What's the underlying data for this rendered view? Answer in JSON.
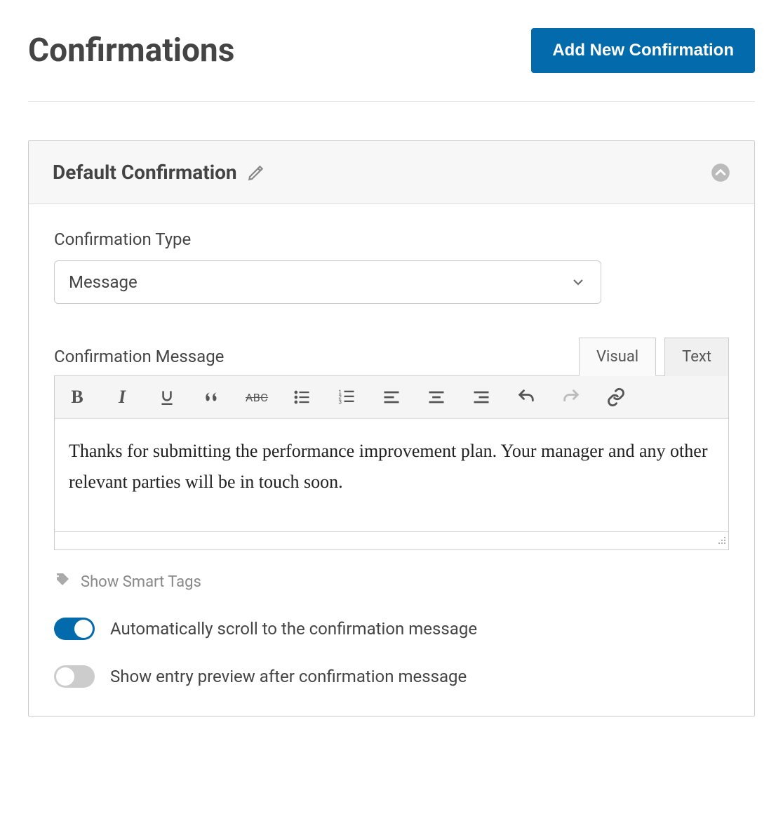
{
  "header": {
    "title": "Confirmations",
    "add_button": "Add New Confirmation"
  },
  "panel": {
    "title": "Default Confirmation",
    "fields": {
      "type_label": "Confirmation Type",
      "type_value": "Message",
      "message_label": "Confirmation Message",
      "message_text": "Thanks for submitting the performance improvement plan. Your manager and any other relevant parties will be in touch soon."
    },
    "tabs": {
      "visual": "Visual",
      "text": "Text"
    },
    "toolbar": {
      "strike_label": "ABC"
    },
    "smart_tags": "Show Smart Tags",
    "options": {
      "auto_scroll": "Automatically scroll to the confirmation message",
      "show_preview": "Show entry preview after confirmation message"
    }
  }
}
